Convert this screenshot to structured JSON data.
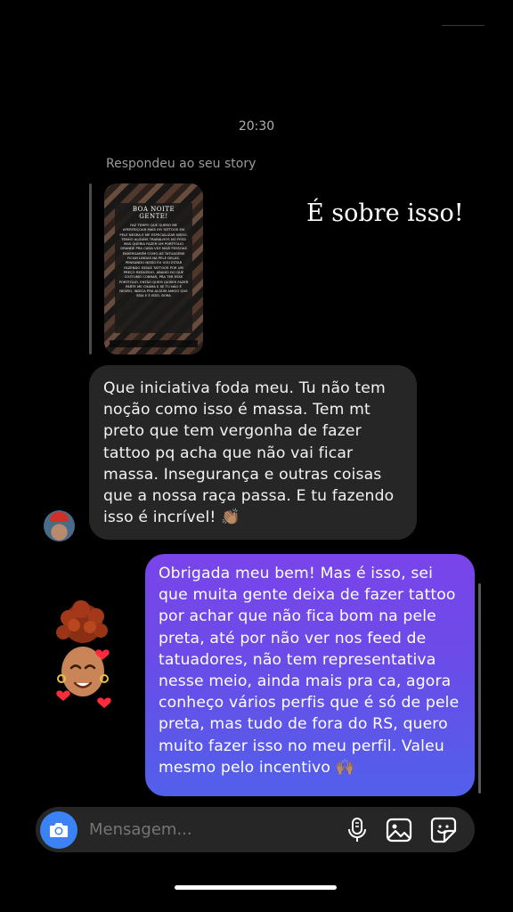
{
  "conversation": {
    "timestamp": "20:30",
    "reply_label": "Respondeu ao seu story",
    "story": {
      "caption": "É sobre isso!",
      "header": "BOA NOITE GENTE!",
      "body": "Faz tempo que quero me aperfeiçoar mais em tattoos em pele negra e me especializar nisso. Tenho alguns trabalhos no feed mas queria fazer um portfólio grande pra cada vez mais pessoas enxergarem como as tatuagens ficam lindas na pele delas. Pensando nisso eu vou estar fazendo essas tattoos por um preço reduzido, abaixo do que costumo cobrar, pra ter esse portfólio. Então quem quiser fazer parte me chama e se tu não é negro, indica pra algum amigo que seja e é isso, bora"
    },
    "messages": [
      {
        "direction": "incoming",
        "text": "Que iniciativa foda meu. Tu não tem noção como isso é massa. Tem mt preto que tem vergonha de fazer tattoo pq acha que não vai ficar massa. Insegurança e outras coisas que a nossa raça passa. E tu fazendo isso é incrível! 👏🏽"
      },
      {
        "direction": "outgoing",
        "text": "Obrigada meu bem! Mas é isso, sei que muita gente deixa de fazer tattoo por achar que não fica bom na pele preta, até por não ver nos feed de tatuadores, não tem representativa nesse meio, ainda mais pra ca, agora conheço vários perfis que é só de pele preta, mas tudo de fora do RS, quero muito fazer isso no meu perfil. Valeu mesmo pelo incentivo 🙌🏽"
      }
    ]
  },
  "composer": {
    "placeholder": "Mensagem...",
    "icons": [
      "camera-icon",
      "microphone-icon",
      "gallery-icon",
      "sticker-icon"
    ]
  },
  "colors": {
    "background": "#000000",
    "incoming_bubble": "#262626",
    "outgoing_gradient_top": "#7a44ea",
    "outgoing_gradient_bottom": "#5160ea",
    "camera_button": "#3b82f6"
  }
}
